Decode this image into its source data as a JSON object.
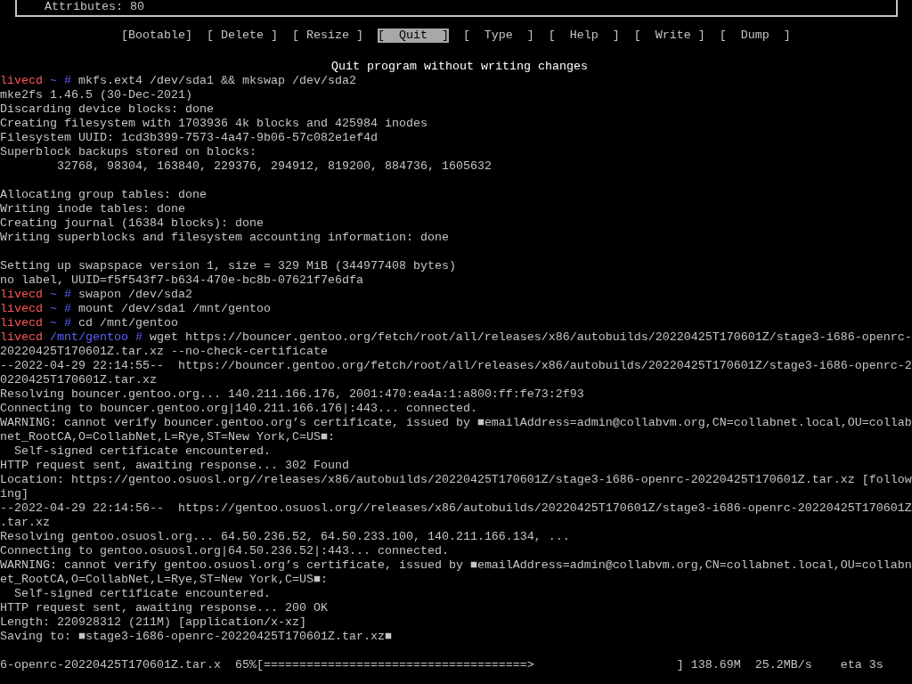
{
  "partition_panel": {
    "text": "Attributes: 80"
  },
  "menu": [
    {
      "label": "[Bootable]",
      "selected": false
    },
    {
      "label": "[ Delete ]",
      "selected": false
    },
    {
      "label": "[ Resize ]",
      "selected": false
    },
    {
      "label": "[  Quit  ]",
      "selected": true
    },
    {
      "label": "[  Type  ]",
      "selected": false
    },
    {
      "label": "[  Help  ]",
      "selected": false
    },
    {
      "label": "[  Write ]",
      "selected": false
    },
    {
      "label": "[  Dump  ]",
      "selected": false
    }
  ],
  "hint": "Quit program without writing changes",
  "terminal_lines": [
    {
      "kind": "prompt",
      "host": "livecd",
      "path": "~",
      "symbol": "#",
      "command": "mkfs.ext4 /dev/sda1 && mkswap /dev/sda2"
    },
    {
      "kind": "output",
      "text": "mke2fs 1.46.5 (30-Dec-2021)"
    },
    {
      "kind": "output",
      "text": "Discarding device blocks: done"
    },
    {
      "kind": "output",
      "text": "Creating filesystem with 1703936 4k blocks and 425984 inodes"
    },
    {
      "kind": "output",
      "text": "Filesystem UUID: 1cd3b399-7573-4a47-9b06-57c082e1ef4d"
    },
    {
      "kind": "output",
      "text": "Superblock backups stored on blocks:"
    },
    {
      "kind": "output",
      "text": "        32768, 98304, 163840, 229376, 294912, 819200, 884736, 1605632"
    },
    {
      "kind": "blank"
    },
    {
      "kind": "output",
      "text": "Allocating group tables: done"
    },
    {
      "kind": "output",
      "text": "Writing inode tables: done"
    },
    {
      "kind": "output",
      "text": "Creating journal (16384 blocks): done"
    },
    {
      "kind": "output",
      "text": "Writing superblocks and filesystem accounting information: done"
    },
    {
      "kind": "blank"
    },
    {
      "kind": "output",
      "text": "Setting up swapspace version 1, size = 329 MiB (344977408 bytes)"
    },
    {
      "kind": "output",
      "text": "no label, UUID=f5f543f7-b634-470e-bc8b-07621f7e6dfa"
    },
    {
      "kind": "prompt",
      "host": "livecd",
      "path": "~",
      "symbol": "#",
      "command": "swapon /dev/sda2"
    },
    {
      "kind": "prompt",
      "host": "livecd",
      "path": "~",
      "symbol": "#",
      "command": "mount /dev/sda1 /mnt/gentoo"
    },
    {
      "kind": "prompt",
      "host": "livecd",
      "path": "~",
      "symbol": "#",
      "command": "cd /mnt/gentoo"
    },
    {
      "kind": "prompt",
      "host": "livecd",
      "path": "/mnt/gentoo",
      "symbol": "#",
      "command": "wget https://bouncer.gentoo.org/fetch/root/all/releases/x86/autobuilds/20220425T170601Z/stage3-i686-openrc-"
    },
    {
      "kind": "output",
      "text": "20220425T170601Z.tar.xz --no-check-certificate"
    },
    {
      "kind": "output",
      "text": "--2022-04-29 22:14:55--  https://bouncer.gentoo.org/fetch/root/all/releases/x86/autobuilds/20220425T170601Z/stage3-i686-openrc-2"
    },
    {
      "kind": "output",
      "text": "0220425T170601Z.tar.xz"
    },
    {
      "kind": "output",
      "text": "Resolving bouncer.gentoo.org... 140.211.166.176, 2001:470:ea4a:1:a800:ff:fe73:2f93"
    },
    {
      "kind": "output",
      "text": "Connecting to bouncer.gentoo.org|140.211.166.176|:443... connected."
    },
    {
      "kind": "output",
      "text": "WARNING: cannot verify bouncer.gentoo.org’s certificate, issued by ■emailAddress=admin@collabvm.org,CN=collabnet.local,OU=collab"
    },
    {
      "kind": "output",
      "text": "net_RootCA,O=CollabNet,L=Rye,ST=New York,C=US■:"
    },
    {
      "kind": "output",
      "text": "  Self-signed certificate encountered."
    },
    {
      "kind": "output",
      "text": "HTTP request sent, awaiting response... 302 Found"
    },
    {
      "kind": "output",
      "text": "Location: https://gentoo.osuosl.org//releases/x86/autobuilds/20220425T170601Z/stage3-i686-openrc-20220425T170601Z.tar.xz [follow"
    },
    {
      "kind": "output",
      "text": "ing]"
    },
    {
      "kind": "output",
      "text": "--2022-04-29 22:14:56--  https://gentoo.osuosl.org//releases/x86/autobuilds/20220425T170601Z/stage3-i686-openrc-20220425T170601Z"
    },
    {
      "kind": "output",
      "text": ".tar.xz"
    },
    {
      "kind": "output",
      "text": "Resolving gentoo.osuosl.org... 64.50.236.52, 64.50.233.100, 140.211.166.134, ..."
    },
    {
      "kind": "output",
      "text": "Connecting to gentoo.osuosl.org|64.50.236.52|:443... connected."
    },
    {
      "kind": "output",
      "text": "WARNING: cannot verify gentoo.osuosl.org’s certificate, issued by ■emailAddress=admin@collabvm.org,CN=collabnet.local,OU=collabn"
    },
    {
      "kind": "output",
      "text": "et_RootCA,O=CollabNet,L=Rye,ST=New York,C=US■:"
    },
    {
      "kind": "output",
      "text": "  Self-signed certificate encountered."
    },
    {
      "kind": "output",
      "text": "HTTP request sent, awaiting response... 200 OK"
    },
    {
      "kind": "output",
      "text": "Length: 220928312 (211M) [application/x-xz]"
    },
    {
      "kind": "output",
      "text": "Saving to: ■stage3-i686-openrc-20220425T170601Z.tar.xz■"
    },
    {
      "kind": "blank"
    },
    {
      "kind": "output",
      "text": "6-openrc-20220425T170601Z.tar.x  65%[=====================================>                    ] 138.69M  25.2MB/s    eta 3s"
    }
  ]
}
